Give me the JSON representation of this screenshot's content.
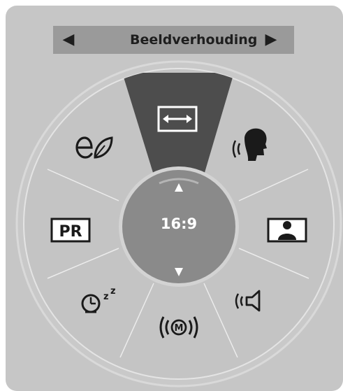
{
  "menu": {
    "title": "Beeldverhouding",
    "current_value": "16:9",
    "nav_left_icon": "triangle-left",
    "nav_right_icon": "triangle-right",
    "up_icon": "triangle-up",
    "down_icon": "triangle-down",
    "items": [
      {
        "name": "aspect-ratio",
        "icon": "double-arrow-icon",
        "selected": true
      },
      {
        "name": "clear-voice",
        "icon": "speaking-head-icon"
      },
      {
        "name": "picture-mode",
        "icon": "person-picture-icon"
      },
      {
        "name": "sound-mode",
        "icon": "speaker-icon"
      },
      {
        "name": "multi-audio",
        "icon": "m-broadcast-icon"
      },
      {
        "name": "sleep-timer",
        "icon": "clock-zzz-icon"
      },
      {
        "name": "program-list",
        "icon": "pr-icon",
        "label": "PR"
      },
      {
        "name": "energy-saving",
        "icon": "eco-leaf-icon"
      }
    ]
  },
  "colors": {
    "panel": "#c6c6c6",
    "header": "#9a9a9a",
    "selected_wedge": "#4d4d4d",
    "center_dial": "#8a8a8a"
  }
}
